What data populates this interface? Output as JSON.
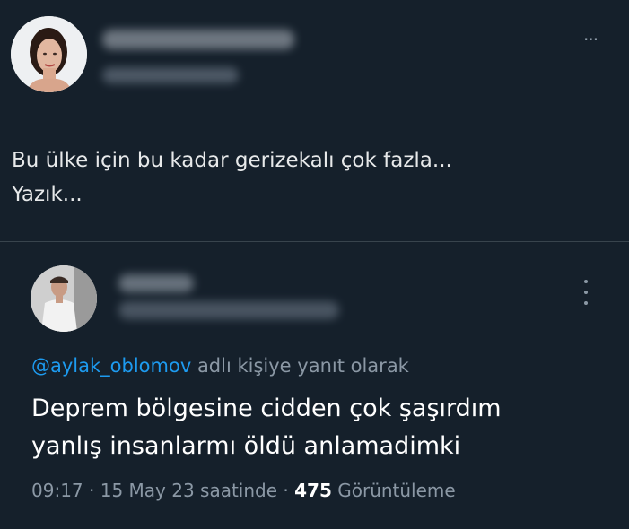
{
  "top_tweet": {
    "text": "Bu ülke için bu kadar gerizekalı çok fazla...\nYazık...",
    "more_label": "···"
  },
  "reply_tweet": {
    "replying_to_handle": "@aylak_oblomov",
    "replying_to_suffix": " adlı kişiye yanıt olarak",
    "text": "Deprem bölgesine cidden çok şaşırdım\nyanlış insanlarmı öldü anlamadimki",
    "time": "09:17",
    "date": "15 May 23 saatinde",
    "views": "475",
    "views_label": "Görüntüleme"
  },
  "colors": {
    "background": "#15202b",
    "link": "#1d9bf0",
    "muted": "#8b98a5",
    "divider": "#38444d"
  }
}
